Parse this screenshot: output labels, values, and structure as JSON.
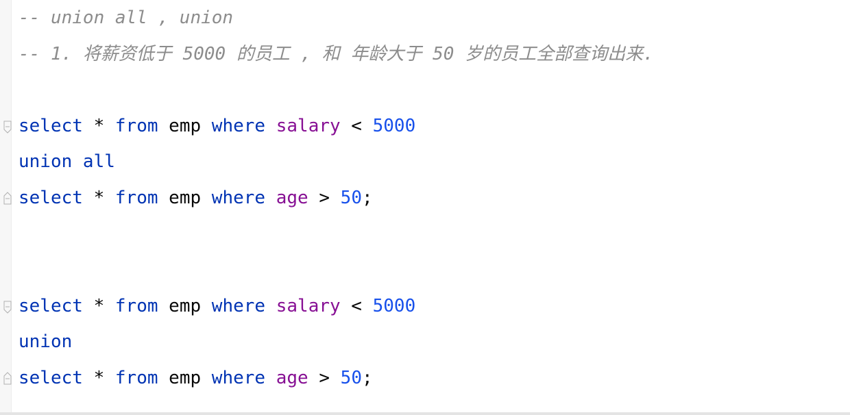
{
  "editor": {
    "comments": [
      "-- union all , union",
      "-- 1. 将薪资低于 5000 的员工 , 和 年龄大于 50 岁的员工全部查询出来."
    ],
    "query1": {
      "line1": {
        "kw_select": "select",
        "star": " * ",
        "kw_from": "from",
        "table": " emp ",
        "kw_where": "where",
        "sp": " ",
        "column": "salary",
        "op": " < ",
        "value": "5000"
      },
      "union": "union all",
      "line3": {
        "kw_select": "select",
        "star": " * ",
        "kw_from": "from",
        "table": " emp ",
        "kw_where": "where",
        "sp": " ",
        "column": "age",
        "op": " > ",
        "value": "50",
        "end": ";"
      }
    },
    "query2": {
      "line1": {
        "kw_select": "select",
        "star": " * ",
        "kw_from": "from",
        "table": " emp ",
        "kw_where": "where",
        "sp": " ",
        "column": "salary",
        "op": " < ",
        "value": "5000"
      },
      "union": "union",
      "line3": {
        "kw_select": "select",
        "star": " * ",
        "kw_from": "from",
        "table": " emp ",
        "kw_where": "where",
        "sp": " ",
        "column": "age",
        "op": " > ",
        "value": "50",
        "end": ";"
      }
    },
    "fold_icon": "fold-marker-icon"
  }
}
